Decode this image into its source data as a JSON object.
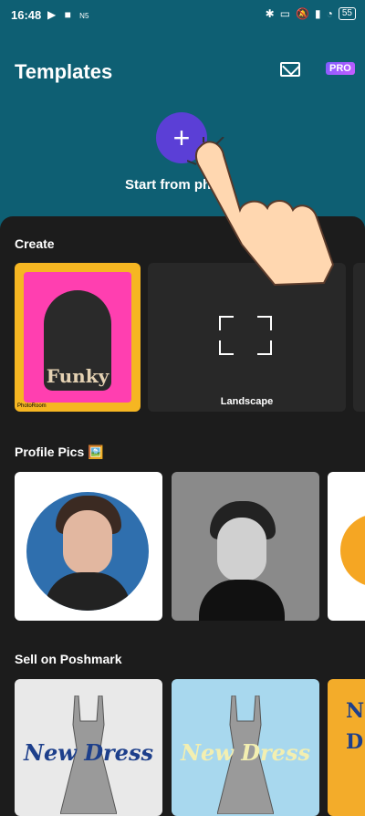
{
  "status_bar": {
    "time": "16:48",
    "left_badge": "N5",
    "battery": "55"
  },
  "header": {
    "title": "Templates",
    "pro_label": "PRO",
    "start_label": "Start from photo"
  },
  "sections": {
    "create": {
      "title": "Create",
      "funky_text": "Funky",
      "funky_watermark": "PhotoRoom",
      "landscape_label": "Landscape"
    },
    "profile": {
      "title": "Profile Pics 🖼️"
    },
    "poshmark": {
      "title": "Sell on Poshmark",
      "dress_text": "New Dress",
      "dress_text_2": "New Dress",
      "partial_text": "Ne\nD"
    }
  },
  "colors": {
    "header_bg": "#0e5f73",
    "accent": "#5b3fd6",
    "sheet_bg": "#1c1c1c"
  }
}
